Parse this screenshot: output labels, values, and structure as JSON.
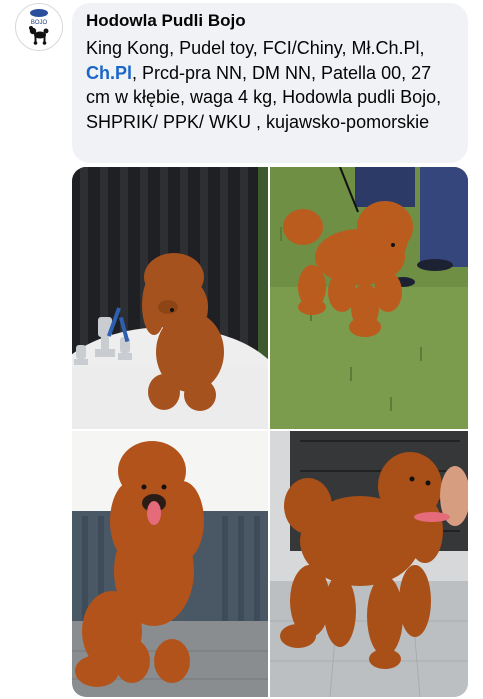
{
  "post": {
    "avatar": {
      "icon": "poodle-logo-icon",
      "logo_text": "BOJO"
    },
    "author": "Hodowla Pudli Bojo",
    "text_before_tag": "King Kong, Pudel toy, FCI/Chiny, Mł.Ch.Pl, ",
    "tag": "Ch.Pl",
    "text_after_tag": ", Prcd-pra NN, DM NN, Patella 00, 27 cm w kłębie, waga 4 kg, Hodowla pudli Bojo, SHPRIK/ PPK/ WKU , kujawsko-pomorskie",
    "colors": {
      "bubble": "#f0f2f5",
      "tag": "#1a66c9",
      "text": "#050505",
      "poodle": "#b2561f"
    },
    "photos": [
      {
        "id": "photo-1",
        "subject": "poodle-with-trophies"
      },
      {
        "id": "photo-2",
        "subject": "poodle-on-grass"
      },
      {
        "id": "photo-3",
        "subject": "poodle-on-bench"
      },
      {
        "id": "photo-4",
        "subject": "poodle-profile"
      }
    ]
  }
}
